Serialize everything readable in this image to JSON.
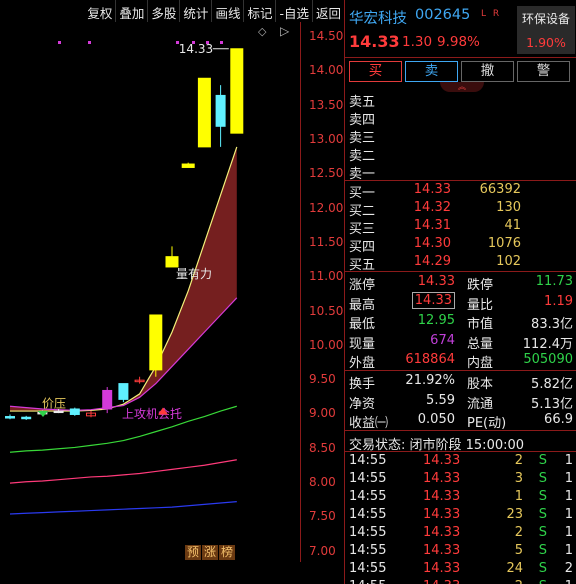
{
  "toolbar": {
    "items": [
      "复权",
      "叠加",
      "多股",
      "统计",
      "画线",
      "标记",
      "-自选",
      "返回"
    ]
  },
  "chart": {
    "price_ticks": [
      "14.50",
      "14.00",
      "13.50",
      "13.00",
      "12.50",
      "12.00",
      "11.50",
      "11.00",
      "10.50",
      "10.00",
      "9.50",
      "9.00",
      "8.50",
      "8.00",
      "7.50",
      "7.00"
    ],
    "price_high_label": "14.33",
    "annotations": {
      "liang_you_li": "量有力",
      "jia_ya": "价压",
      "shang_gong": "上攻机会托"
    },
    "badge_chars": [
      "预",
      "涨",
      "榜"
    ],
    "corner_icon": "diamond-icon",
    "colors": {
      "up": "#ff3b3b",
      "limit_up_candle": "#ffff00",
      "down_candle": "#5ff0ff",
      "ma_yellow": "#f4f07a",
      "ma_magenta": "#d43ad8",
      "ma_green": "#38d838",
      "ma_pink": "#ff3a7a",
      "ma_blue": "#2a3af0",
      "band_fill": "#8a2424"
    }
  },
  "chart_data": {
    "type": "candlestick",
    "title": "",
    "ylim": [
      6.85,
      14.72
    ],
    "y_ticks": [
      14.5,
      14.0,
      13.5,
      13.0,
      12.5,
      12.0,
      11.5,
      11.0,
      10.5,
      10.0,
      9.5,
      9.0,
      8.5,
      8.0,
      7.5,
      7.0
    ],
    "candles": [
      {
        "open": 8.97,
        "high": 9.0,
        "low": 8.93,
        "close": 8.95,
        "color": "cyan"
      },
      {
        "open": 8.95,
        "high": 8.98,
        "low": 8.92,
        "close": 8.96,
        "color": "cyan"
      },
      {
        "open": 9.02,
        "high": 9.06,
        "low": 8.99,
        "close": 9.03,
        "color": "white"
      },
      {
        "open": 9.05,
        "high": 9.08,
        "low": 9.02,
        "close": 9.04,
        "color": "white"
      },
      {
        "open": 9.0,
        "high": 9.1,
        "low": 8.98,
        "close": 9.08,
        "color": "cyan"
      },
      {
        "open": 8.98,
        "high": 9.05,
        "low": 8.96,
        "close": 9.02,
        "color": "red"
      },
      {
        "open": 9.08,
        "high": 9.4,
        "low": 9.02,
        "close": 9.35,
        "color": "magenta"
      },
      {
        "open": 9.22,
        "high": 9.45,
        "low": 9.18,
        "close": 9.45,
        "color": "cyan"
      },
      {
        "open": 9.48,
        "high": 9.55,
        "low": 9.45,
        "close": 9.5,
        "color": "red"
      },
      {
        "open": 9.65,
        "high": 10.45,
        "low": 9.55,
        "close": 10.45,
        "color": "yellow"
      },
      {
        "open": 11.3,
        "high": 11.45,
        "low": 11.15,
        "close": 11.15,
        "color": "yellow"
      },
      {
        "open": 12.6,
        "high": 12.67,
        "low": 12.6,
        "close": 12.65,
        "color": "yellow"
      },
      {
        "open": 12.9,
        "high": 13.9,
        "low": 12.9,
        "close": 13.9,
        "color": "yellow"
      },
      {
        "open": 13.2,
        "high": 13.8,
        "low": 12.9,
        "close": 13.65,
        "color": "cyan"
      },
      {
        "open": 13.1,
        "high": 14.33,
        "low": 13.1,
        "close": 14.33,
        "color": "yellow"
      }
    ],
    "series": [
      {
        "values": [
          9.05,
          9.05,
          9.05,
          9.05,
          9.05,
          9.06,
          9.08,
          9.15,
          9.3,
          9.7,
          10.2,
          10.8,
          11.5,
          12.2,
          12.9
        ]
      },
      {
        "values": [
          9.12,
          9.1,
          9.08,
          9.07,
          9.06,
          9.07,
          9.1,
          9.13,
          9.25,
          9.45,
          9.7,
          9.95,
          10.2,
          10.45,
          10.7
        ]
      },
      {
        "values": [
          8.45,
          8.47,
          8.48,
          8.5,
          8.52,
          8.55,
          8.58,
          8.62,
          8.68,
          8.75,
          8.82,
          8.9,
          8.97,
          9.05,
          9.12
        ]
      },
      {
        "values": [
          8.0,
          8.02,
          8.03,
          8.05,
          8.07,
          8.09,
          8.1,
          8.12,
          8.14,
          8.17,
          8.2,
          8.23,
          8.26,
          8.3,
          8.34
        ]
      },
      {
        "values": [
          7.55,
          7.56,
          7.57,
          7.58,
          7.59,
          7.6,
          7.61,
          7.62,
          7.63,
          7.64,
          7.65,
          7.67,
          7.69,
          7.71,
          7.73
        ]
      }
    ]
  },
  "quote": {
    "name": "华宏科技",
    "code": "002645",
    "flags": "L R",
    "price": "14.33",
    "change": "1.30",
    "change_pct": "9.98%",
    "sector_name": "环保设备",
    "sector_pct": "1.90%"
  },
  "trade_buttons": [
    "买",
    "卖",
    "撤",
    "警"
  ],
  "collapse_icon": "double-chevron-up-icon",
  "asks": [
    {
      "label": "卖五",
      "price": "",
      "volume": ""
    },
    {
      "label": "卖四",
      "price": "",
      "volume": ""
    },
    {
      "label": "卖三",
      "price": "",
      "volume": ""
    },
    {
      "label": "卖二",
      "price": "",
      "volume": ""
    },
    {
      "label": "卖一",
      "price": "",
      "volume": ""
    }
  ],
  "bids": [
    {
      "label": "买一",
      "price": "14.33",
      "volume": "66392"
    },
    {
      "label": "买二",
      "price": "14.32",
      "volume": "130"
    },
    {
      "label": "买三",
      "price": "14.31",
      "volume": "41"
    },
    {
      "label": "买四",
      "price": "14.30",
      "volume": "1076"
    },
    {
      "label": "买五",
      "price": "14.29",
      "volume": "102"
    }
  ],
  "stats": {
    "zhangting_label": "涨停",
    "zhangting": "14.33",
    "dieting_label": "跌停",
    "dieting": "11.73",
    "zuigao_label": "最高",
    "zuigao": "14.33",
    "liangbi_label": "量比",
    "liangbi": "1.19",
    "zuidi_label": "最低",
    "zuidi": "12.95",
    "shizhi_label": "市值",
    "shizhi": "83.3亿",
    "xianliang_label": "现量",
    "xianliang": "674",
    "zongliang_label": "总量",
    "zongliang": "112.4万",
    "waipan_label": "外盘",
    "waipan": "618864",
    "neipan_label": "内盘",
    "neipan": "505090",
    "huanshou_label": "换手",
    "huanshou": "21.92%",
    "guben_label": "股本",
    "guben": "5.82亿",
    "jingzi_label": "净资",
    "jingzi": "5.59",
    "liutong_label": "流通",
    "liutong": "5.13亿",
    "shouyi_label": "收益㈠",
    "shouyi": "0.050",
    "pe_label": "PE(动)",
    "pe": "66.9"
  },
  "status_line": "交易状态: 闭市阶段 15:00:00",
  "ticks": [
    {
      "time": "14:55",
      "price": "14.33",
      "volume": "2",
      "dir": "S",
      "num": "1"
    },
    {
      "time": "14:55",
      "price": "14.33",
      "volume": "3",
      "dir": "S",
      "num": "1"
    },
    {
      "time": "14:55",
      "price": "14.33",
      "volume": "1",
      "dir": "S",
      "num": "1"
    },
    {
      "time": "14:55",
      "price": "14.33",
      "volume": "23",
      "dir": "S",
      "num": "1"
    },
    {
      "time": "14:55",
      "price": "14.33",
      "volume": "2",
      "dir": "S",
      "num": "1"
    },
    {
      "time": "14:55",
      "price": "14.33",
      "volume": "5",
      "dir": "S",
      "num": "1"
    },
    {
      "time": "14:55",
      "price": "14.33",
      "volume": "24",
      "dir": "S",
      "num": "2"
    },
    {
      "time": "14:55",
      "price": "14.33",
      "volume": "2",
      "dir": "S",
      "num": "1"
    }
  ]
}
